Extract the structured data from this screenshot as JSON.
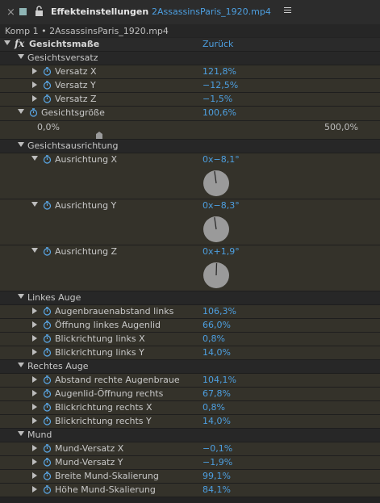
{
  "header": {
    "close_glyph": "×",
    "title": "Effekteinstellungen",
    "file": "2AssassinsParis_1920.mp4"
  },
  "subheader": {
    "path": "Komp 1 • 2AssassinsParis_1920.mp4"
  },
  "effect": {
    "name": "Gesichtsmaße",
    "reset_label": "Zurück"
  },
  "face_offset": {
    "label": "Gesichtsversatz",
    "items": [
      {
        "label": "Versatz X",
        "value": "121,8%"
      },
      {
        "label": "Versatz Y",
        "value": "−12,5%"
      },
      {
        "label": "Versatz Z",
        "value": "−1,5%"
      }
    ]
  },
  "face_size": {
    "label": "Gesichtsgröße",
    "value": "100,6%",
    "slider_min": "0,0%",
    "slider_max": "500,0%",
    "slider_fraction": 0.2
  },
  "face_orientation": {
    "label": "Gesichtsausrichtung",
    "items": [
      {
        "label": "Ausrichtung X",
        "value": "0x−8,1°",
        "angle": -8.1
      },
      {
        "label": "Ausrichtung Y",
        "value": "0x−8,3°",
        "angle": -8.3
      },
      {
        "label": "Ausrichtung Z",
        "value": "0x+1,9°",
        "angle": 1.9
      }
    ]
  },
  "left_eye": {
    "label": "Linkes Auge",
    "items": [
      {
        "label": "Augenbrauenabstand links",
        "value": "106,3%"
      },
      {
        "label": "Öffnung linkes Augenlid",
        "value": "66,0%"
      },
      {
        "label": "Blickrichtung links X",
        "value": "0,8%"
      },
      {
        "label": "Blickrichtung links Y",
        "value": "14,0%"
      }
    ]
  },
  "right_eye": {
    "label": "Rechtes Auge",
    "items": [
      {
        "label": "Abstand rechte Augenbraue",
        "value": "104,1%"
      },
      {
        "label": "Augenlid-Öffnung rechts",
        "value": "67,8%"
      },
      {
        "label": "Blickrichtung rechts X",
        "value": "0,8%"
      },
      {
        "label": "Blickrichtung rechts Y",
        "value": "14,0%"
      }
    ]
  },
  "mouth": {
    "label": "Mund",
    "items": [
      {
        "label": "Mund-Versatz X",
        "value": "−0,1%"
      },
      {
        "label": "Mund-Versatz Y",
        "value": "−1,9%"
      },
      {
        "label": "Breite Mund-Skalierung",
        "value": "99,1%"
      },
      {
        "label": "Höhe Mund-Skalierung",
        "value": "84,1%"
      }
    ]
  },
  "colors": {
    "value_blue": "#4d9fe0",
    "panel_bg": "#232323",
    "row_bg": "#34322a"
  },
  "icons": {
    "stopwatch": "stopwatch-icon",
    "lock": "lock-icon",
    "menu": "panel-menu-icon"
  }
}
